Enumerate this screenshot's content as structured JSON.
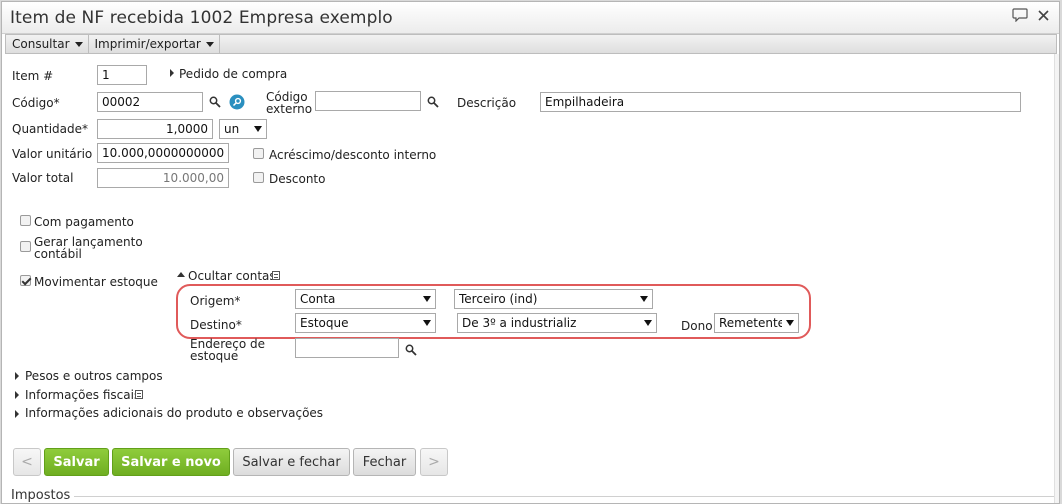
{
  "window": {
    "title": "Item de NF recebida 1002 Empresa exemplo"
  },
  "menubar": {
    "items": [
      "Consultar",
      "Imprimir/exportar"
    ]
  },
  "form": {
    "item_label": "Item #",
    "item_value": "1",
    "pedido_label": "Pedido de compra",
    "codigo_label": "Código*",
    "codigo_value": "00002",
    "codigo_externo_label": "Código externo",
    "codigo_externo_value": "",
    "descricao_label": "Descrição",
    "descricao_value": "Empilhadeira",
    "quantidade_label": "Quantidade*",
    "quantidade_value": "1,0000",
    "unidade_value": "un",
    "valor_unitario_label": "Valor unitário",
    "valor_unitario_value": "10.000,0000000000",
    "acrescimo_label": "Acréscimo/desconto interno",
    "valor_total_label": "Valor total",
    "valor_total_value": "10.000,00",
    "desconto_label": "Desconto",
    "com_pagamento_label": "Com pagamento",
    "gerar_lancamento_label": "Gerar lançamento contábil",
    "movimentar_estoque_label": "Movimentar estoque",
    "ocultar_contas_label": "Ocultar contas",
    "origem_label": "Origem*",
    "origem_value": "Conta",
    "origem_detail_value": "Terceiro (ind)",
    "destino_label": "Destino*",
    "destino_value": "Estoque",
    "destino_detail_value": "De 3º a industrializ",
    "dono_label": "Dono",
    "dono_value": "Remetente",
    "endereco_label": "Endereço de estoque",
    "endereco_value": "",
    "pesos_label": "Pesos e outros campos",
    "info_fiscais_label": "Informações fiscais",
    "info_adicionais_label": "Informações adicionais do produto e observações"
  },
  "buttons": {
    "prev": "<",
    "salvar": "Salvar",
    "salvar_novo": "Salvar e novo",
    "salvar_fechar": "Salvar e fechar",
    "fechar": "Fechar",
    "next": ">"
  },
  "section": {
    "impostos": "Impostos"
  },
  "checks": {
    "com_pagamento": false,
    "gerar_lancamento": false,
    "movimentar_estoque": true,
    "acrescimo": false,
    "desconto": false
  },
  "colors": {
    "accent_green": "#7abb2c",
    "highlight": "#e05a5a"
  }
}
